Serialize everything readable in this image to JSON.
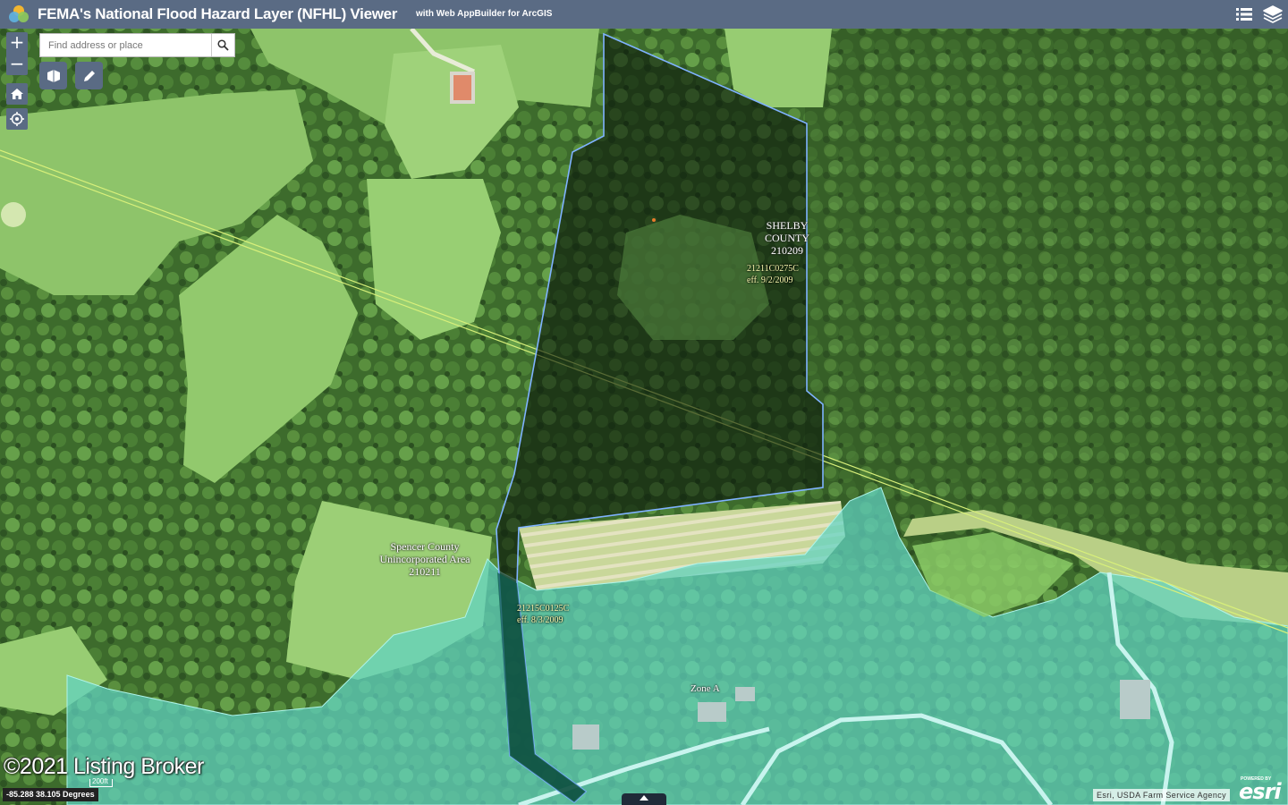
{
  "header": {
    "title": "FEMA's National Flood Hazard Layer (NFHL) Viewer",
    "subtitle": "with Web AppBuilder for ArcGIS",
    "list_icon": "list-icon",
    "layers_icon": "layers-icon"
  },
  "search": {
    "placeholder": "Find address or place",
    "icon": "search-icon"
  },
  "zoom": {
    "in_label": "+",
    "out_label": "−"
  },
  "map_labels": {
    "shelby": [
      "SHELBY",
      "COUNTY",
      "210209"
    ],
    "spencer": [
      "Spencer County",
      "Unincorporated Area",
      "210211"
    ],
    "zone": "Zone A"
  },
  "panel_labels": {
    "shelby_panel": [
      "21211C0275C",
      "eff. 9/2/2009"
    ],
    "spencer_panel": [
      "21215C0125C",
      "eff. 8/3/2009"
    ]
  },
  "watermark": "©2021 Listing Broker",
  "coordinates": "-85.288 38.105 Degrees",
  "scale_label": "200ft",
  "attribution": "Esri, USDA Farm Service Agency",
  "esri": {
    "powered_by": "POWERED BY",
    "logo": "esri"
  },
  "colors": {
    "header": "#5a6b84",
    "flood_zone": "#5fd3c4",
    "parcel_fill": "#0b1a0b",
    "parcel_outline": "#7fb2ff",
    "transmission_line": "#d8f07a"
  }
}
